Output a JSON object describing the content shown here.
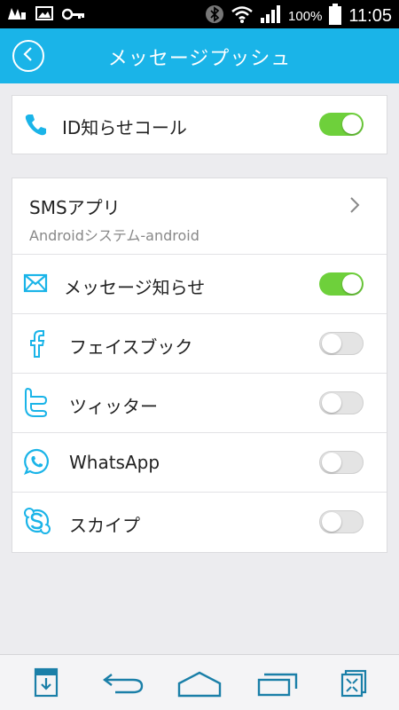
{
  "status_bar": {
    "battery_percent": "100%",
    "time": "11:05"
  },
  "header": {
    "title": "メッセージプッシュ"
  },
  "id_call": {
    "label": "ID知らせコール",
    "enabled": true
  },
  "sms_app": {
    "title": "SMSアプリ",
    "subtitle": "Androidシステム-android"
  },
  "notifications": [
    {
      "label": "メッセージ知らせ",
      "icon": "envelope-icon",
      "enabled": true
    },
    {
      "label": "フェイスブック",
      "icon": "facebook-icon",
      "enabled": false
    },
    {
      "label": "ツィッター",
      "icon": "twitter-icon",
      "enabled": false
    },
    {
      "label": "WhatsApp",
      "icon": "whatsapp-icon",
      "enabled": false
    },
    {
      "label": "スカイプ",
      "icon": "skype-icon",
      "enabled": false
    }
  ],
  "colors": {
    "accent": "#1ab4e8",
    "toggle_on": "#6ed03b",
    "background": "#ececef"
  }
}
